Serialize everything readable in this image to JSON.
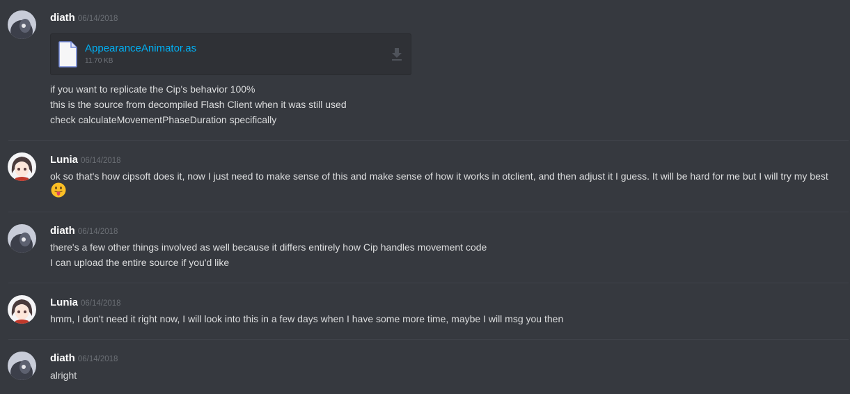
{
  "colors": {
    "background": "#36393f",
    "username": "#ffffff",
    "timestamp": "#6b6f75",
    "link": "#00b0f4",
    "text": "#dcddde"
  },
  "messages": [
    {
      "author": "diath",
      "timestamp": "06/14/2018",
      "avatar": "diath-avatar",
      "attachment": {
        "filename": "AppearanceAnimator.as",
        "size": "11.70 KB",
        "icon": "file-icon",
        "action_icon": "download-icon"
      },
      "lines": [
        "if you want to replicate the Cip's behavior 100%",
        "this is the source from decompiled Flash Client when it was still used",
        "check calculateMovementPhaseDuration specifically"
      ]
    },
    {
      "author": "Lunia",
      "timestamp": "06/14/2018",
      "avatar": "lunia-avatar",
      "lines": [
        "ok so that's how cipsoft does it, now I just need to make sense of this and make sense of how it works in otclient, and then adjust it I guess. It will be hard for me but I will try my best"
      ],
      "emoji": "tongue-out-emoji"
    },
    {
      "author": "diath",
      "timestamp": "06/14/2018",
      "avatar": "diath-avatar",
      "lines": [
        "there's a few other things involved as well because it differs entirely how Cip handles movement code",
        "I can upload the entire source if you'd like"
      ]
    },
    {
      "author": "Lunia",
      "timestamp": "06/14/2018",
      "avatar": "lunia-avatar",
      "lines": [
        "hmm, I don't need it right now, I will look into this in a few days when I have some more time, maybe I will msg you then"
      ]
    },
    {
      "author": "diath",
      "timestamp": "06/14/2018",
      "avatar": "diath-avatar",
      "lines": [
        "alright"
      ]
    }
  ]
}
